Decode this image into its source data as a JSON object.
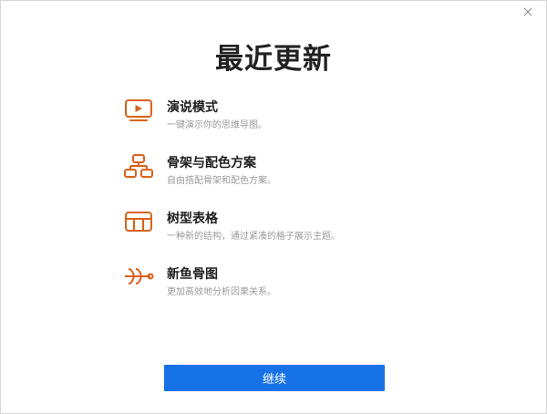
{
  "window": {
    "close_label": "×"
  },
  "title": "最近更新",
  "features": [
    {
      "icon": "presentation-icon",
      "title": "演说模式",
      "desc": "一键演示你的思维导图。"
    },
    {
      "icon": "skeleton-icon",
      "title": "骨架与配色方案",
      "desc": "自由搭配骨架和配色方案。"
    },
    {
      "icon": "table-icon",
      "title": "树型表格",
      "desc": "一种新的结构，通过紧凑的格子展示主题。"
    },
    {
      "icon": "fishbone-icon",
      "title": "新鱼骨图",
      "desc": "更加高效地分析因果关系。"
    }
  ],
  "continue_label": "继续",
  "colors": {
    "accent_icon": "#d9621c",
    "button_bg": "#1672e6",
    "button_text": "#ffffff"
  }
}
